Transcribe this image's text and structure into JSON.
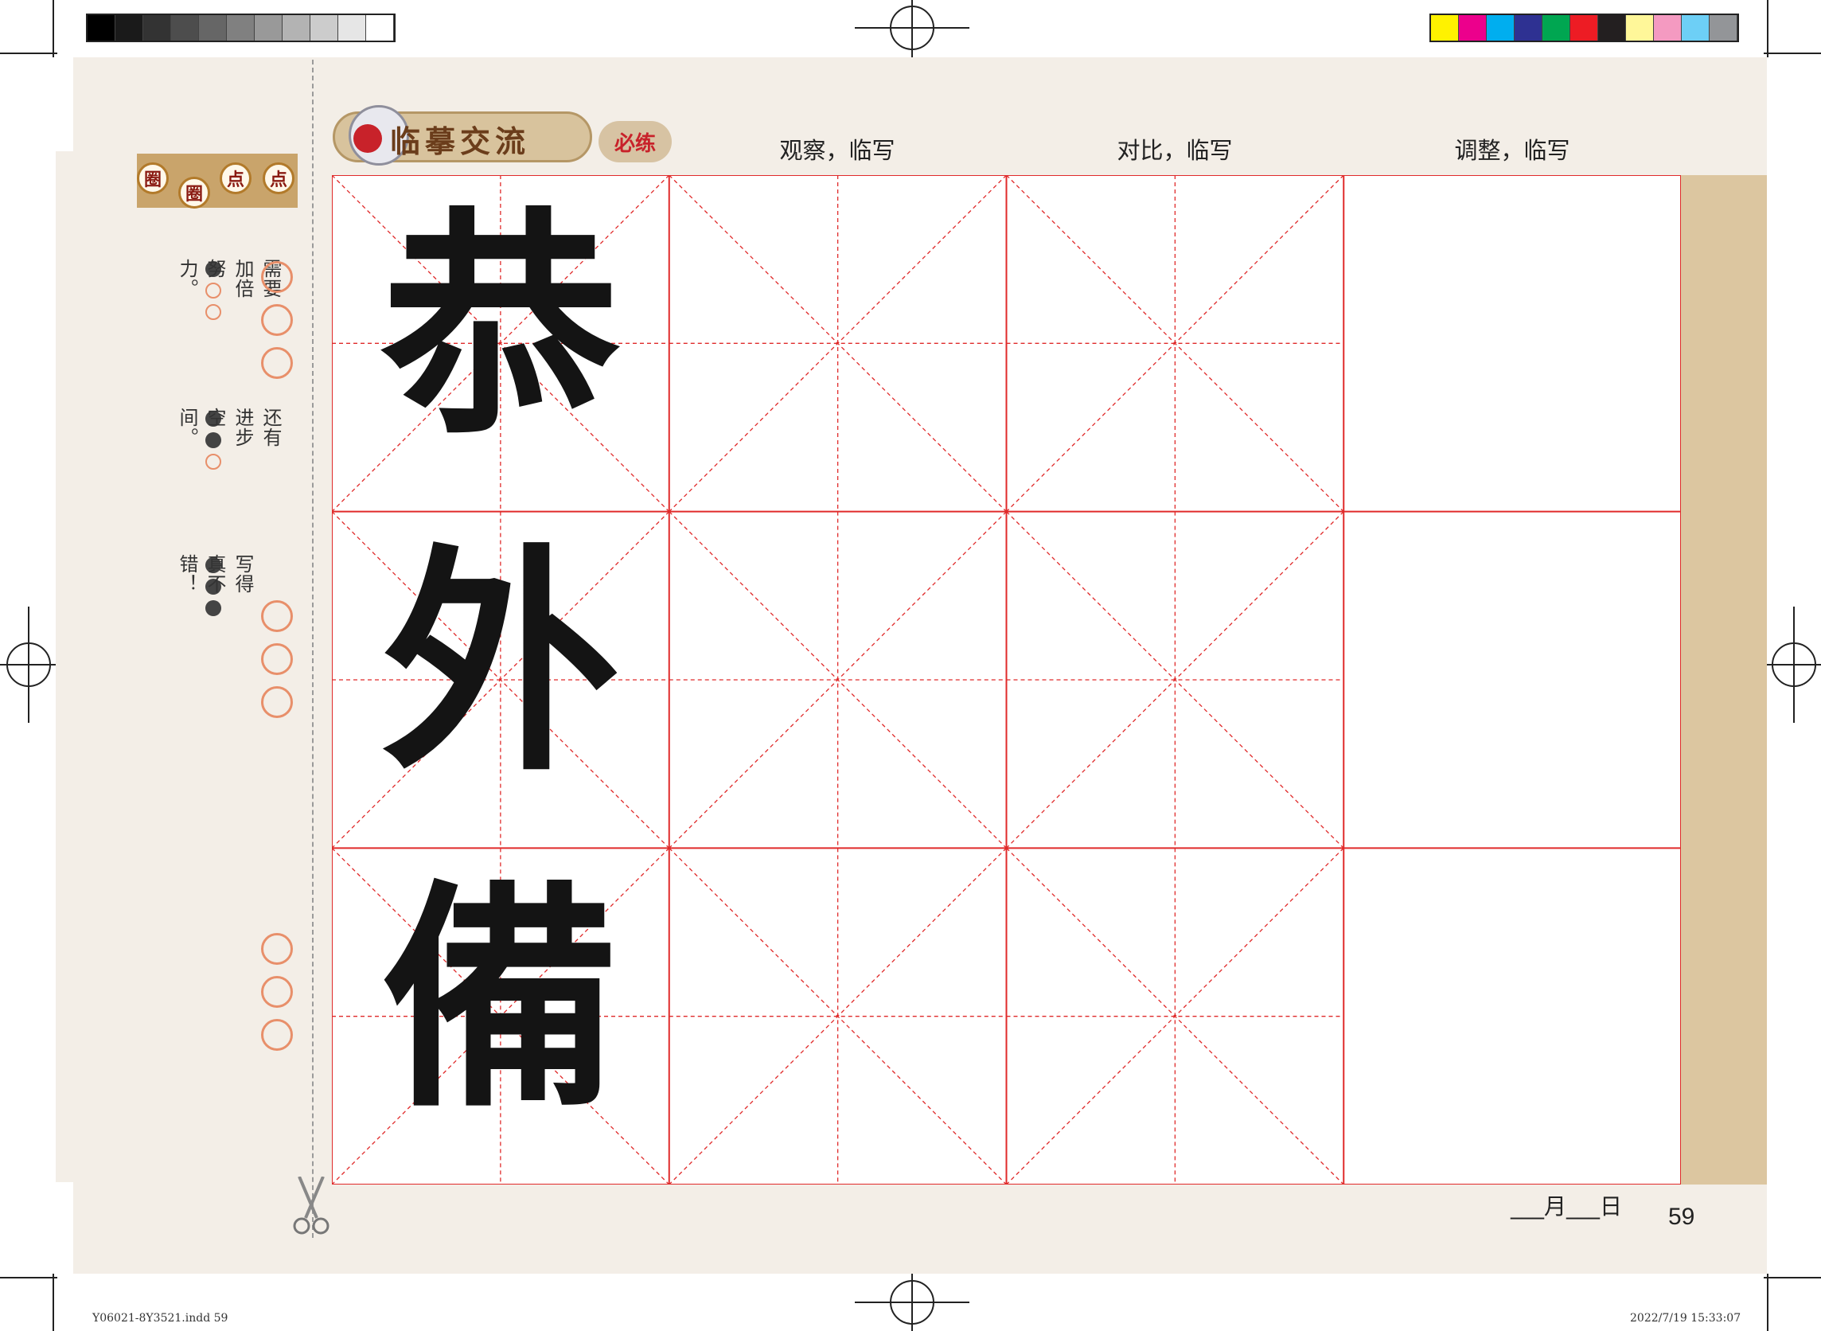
{
  "colors": {
    "grid_red": "#e02a2a",
    "page_bg": "#f3eee7",
    "accent_orange": "#e88f6a",
    "title_brown": "#6b3d1b",
    "seal_red": "#c8222a"
  },
  "print_marks": {
    "gray_swatches": [
      "#000000",
      "#1a1a1a",
      "#333333",
      "#4d4d4d",
      "#666666",
      "#808080",
      "#999999",
      "#b3b3b3",
      "#cccccc",
      "#e6e6e6",
      "#ffffff"
    ],
    "color_swatches": [
      "#fff200",
      "#ec008c",
      "#00aeef",
      "#2e3192",
      "#00a651",
      "#ed1c24",
      "#231f20",
      "#fff799",
      "#f49ac1",
      "#6dcff6",
      "#939598"
    ]
  },
  "sidebar": {
    "badge_chars": [
      "圈",
      "圈",
      "点",
      "点"
    ],
    "ratings": [
      {
        "text": "需要加倍努力。",
        "dots": [
          "filled",
          "open",
          "open"
        ]
      },
      {
        "text": "还有进步空间。",
        "dots": [
          "filled",
          "filled",
          "open"
        ]
      },
      {
        "text": "写得真不错！",
        "dots": [
          "filled",
          "filled",
          "filled"
        ]
      }
    ],
    "scissors_icon": "scissors-icon"
  },
  "header": {
    "title": "临摹交流",
    "required_badge": "必练",
    "columns": [
      "观察，临写",
      "对比，临写",
      "调整，临写"
    ]
  },
  "practice": {
    "characters": [
      "恭",
      "外",
      "備"
    ]
  },
  "footer": {
    "date": "___月___日",
    "page_number": "59",
    "slug_left": "Y06021-8Y3521.indd   59",
    "slug_right": "2022/7/19   15:33:07"
  }
}
